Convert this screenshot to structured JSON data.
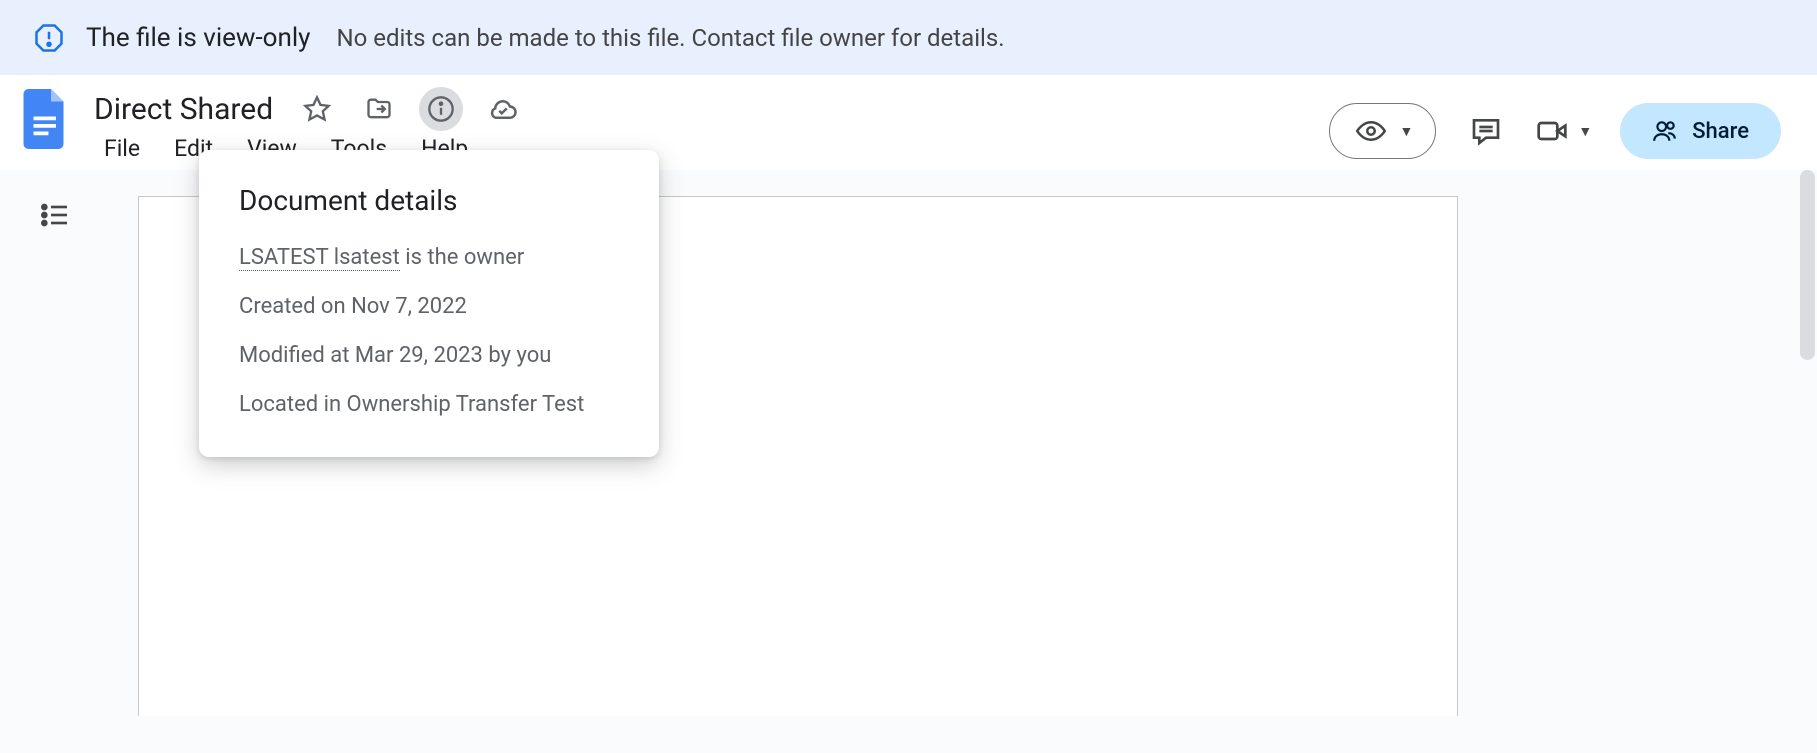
{
  "banner": {
    "title": "The file is view-only",
    "message": "No edits can be made to this file. Contact file owner for details."
  },
  "document": {
    "title": "Direct Shared"
  },
  "menu": {
    "file": "File",
    "edit": "Edit",
    "view": "View",
    "tools": "Tools",
    "help": "Help"
  },
  "share": {
    "label": "Share"
  },
  "popover": {
    "heading": "Document details",
    "owner_name": "LSATEST lsatest",
    "owner_suffix": " is the owner",
    "created": "Created on Nov 7, 2022",
    "modified": "Modified at Mar 29, 2023 by you",
    "located": "Located in Ownership Transfer Test"
  }
}
